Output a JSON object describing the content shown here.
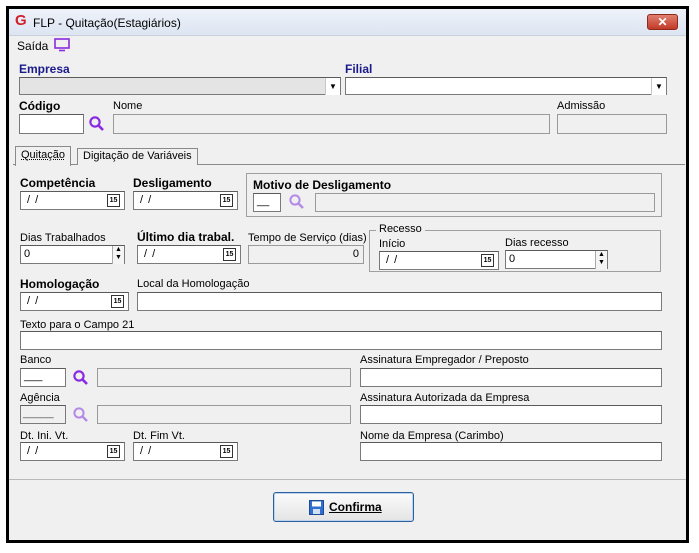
{
  "window": {
    "title": "FLP - Quitação(Estagiários)",
    "close_glyph": "✕",
    "logo_glyph": "G"
  },
  "menu": {
    "exit_label": "Saída"
  },
  "header": {
    "empresa_label": "Empresa",
    "filial_label": "Filial",
    "codigo_label": "Código",
    "nome_label": "Nome",
    "admissao_label": "Admissão",
    "empresa_value": "",
    "filial_value": "",
    "codigo_value": ""
  },
  "tabs": [
    {
      "label": "Quitação",
      "active": true
    },
    {
      "label": "Digitação de Variáveis",
      "active": false
    }
  ],
  "form": {
    "competencia_label": "Competência",
    "competencia_value": "/ /",
    "desligamento_label": "Desligamento",
    "desligamento_value": "/ /",
    "motivo_label": "Motivo de Desligamento",
    "motivo_code": "__",
    "dias_trab_label": "Dias Trabalhados",
    "dias_trab_value": "0",
    "ultimo_dia_label": "Último dia trabal.",
    "ultimo_dia_value": "/ /",
    "tempo_servico_label": "Tempo de Serviço (dias)",
    "tempo_servico_value": "0",
    "recesso_label": "Recesso",
    "recesso_inicio_label": "Início",
    "recesso_inicio_value": "/ /",
    "dias_recesso_label": "Dias recesso",
    "dias_recesso_value": "0",
    "homologacao_label": "Homologação",
    "homologacao_value": "/ /",
    "local_homologacao_label": "Local da Homologação",
    "texto_campo21_label": "Texto para o Campo 21",
    "banco_label": "Banco",
    "banco_code": "___",
    "agencia_label": "Agência",
    "agencia_code": "_____",
    "assinatura_empregador_label": "Assinatura Empregador / Preposto",
    "assinatura_autorizada_label": "Assinatura Autorizada da Empresa",
    "dt_ini_vt_label": "Dt. Ini. Vt.",
    "dt_ini_vt_value": "/ /",
    "dt_fim_vt_label": "Dt. Fim Vt.",
    "dt_fim_vt_value": "/ /",
    "nome_empresa_label": "Nome da Empresa (Carimbo)"
  },
  "footer": {
    "confirm_label": "Confirma"
  },
  "colors": {
    "accent_purple": "#8a2be2",
    "label_blue": "#1a1a8c",
    "logo_red": "#d0202a"
  },
  "icons": {
    "search": "search-icon",
    "calendar": "calendar-icon",
    "save": "save-icon",
    "monitor": "monitor-icon"
  }
}
